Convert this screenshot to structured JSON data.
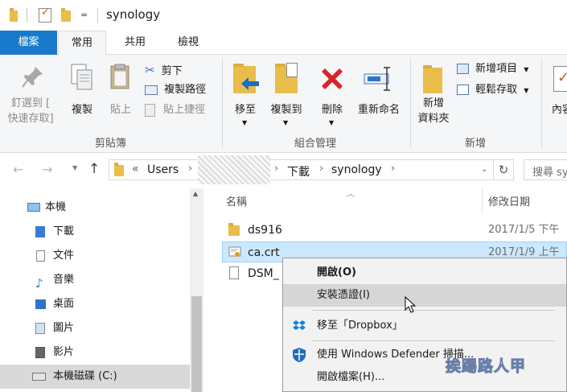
{
  "window": {
    "title": "synology"
  },
  "quick_access": {
    "dropdown_glyph": "="
  },
  "ribbon_tabs": [
    {
      "label": "檔案",
      "active": false
    },
    {
      "label": "常用",
      "active": true
    },
    {
      "label": "共用",
      "active": false
    },
    {
      "label": "檢視",
      "active": false
    }
  ],
  "clipboard": {
    "pin_label_line1": "釘選到 [",
    "pin_label_line2": "快速存取]",
    "copy_label": "複製",
    "paste_label": "貼上",
    "cut_label": "剪下",
    "copy_path_label": "複製路徑",
    "paste_shortcut_label": "貼上捷徑",
    "group_label": "剪貼簿"
  },
  "organize": {
    "move_to_label": "移至",
    "copy_to_label": "複製到",
    "delete_label": "刪除",
    "rename_label": "重新命名",
    "group_label": "組合管理"
  },
  "new": {
    "new_folder_line1": "新增",
    "new_folder_line2": "資料夾",
    "new_item_label": "新增項目",
    "easy_access_label": "輕鬆存取",
    "group_label": "新增"
  },
  "open_group": {
    "properties_label": "內容"
  },
  "address": {
    "prefix": "«",
    "crumbs": [
      "Users",
      "下載",
      "synology"
    ],
    "search_placeholder": "搜尋 sy"
  },
  "tree": [
    {
      "label": "本機"
    },
    {
      "label": "下載"
    },
    {
      "label": "文件"
    },
    {
      "label": "音樂"
    },
    {
      "label": "桌面"
    },
    {
      "label": "圖片"
    },
    {
      "label": "影片"
    },
    {
      "label": "本機磁碟 (C:)"
    }
  ],
  "columns": {
    "name": "名稱",
    "modified": "修改日期"
  },
  "files": [
    {
      "name": "ds916",
      "date": "2017/1/5 下午"
    },
    {
      "name": "ca.crt",
      "date": "2017/1/9 上午"
    },
    {
      "name": "DSM_",
      "date": ""
    }
  ],
  "context_menu": [
    {
      "label": "開啟(O)",
      "bold": true
    },
    {
      "label": "安裝憑證(I)"
    },
    {
      "label": "移至「Dropbox」"
    },
    {
      "label": "使用 Windows Defender 掃描..."
    },
    {
      "label": "開啟檔案(H)..."
    }
  ],
  "watermark": "挨踢路人甲"
}
